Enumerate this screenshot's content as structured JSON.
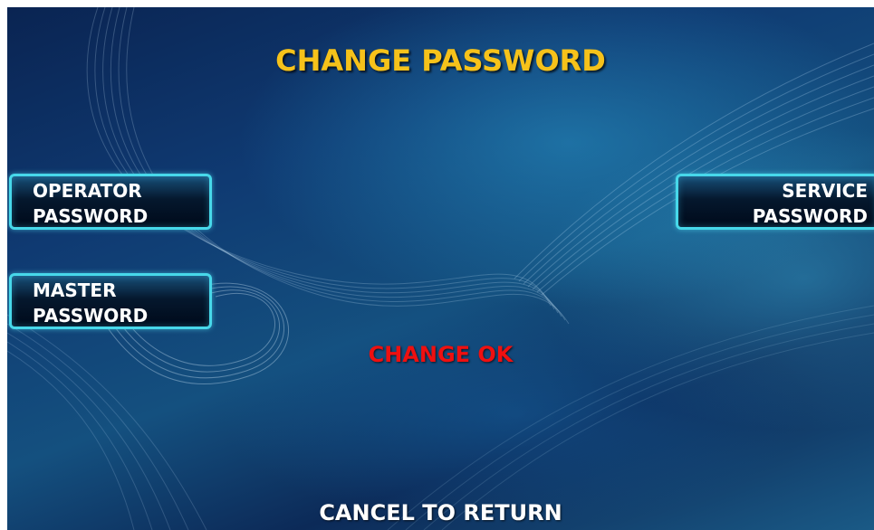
{
  "screen": {
    "title": "CHANGE PASSWORD",
    "status": "CHANGE OK",
    "footer": "CANCEL TO RETURN"
  },
  "buttons": {
    "operator": {
      "line1": "OPERATOR",
      "line2": "PASSWORD"
    },
    "master": {
      "line1": "MASTER",
      "line2": "PASSWORD"
    },
    "service": {
      "line1": "SERVICE",
      "line2": "PASSWORD"
    }
  },
  "colors": {
    "title": "#f6c21a",
    "status": "#ee1010",
    "button_border": "#47d8ea",
    "text": "#ffffff"
  }
}
